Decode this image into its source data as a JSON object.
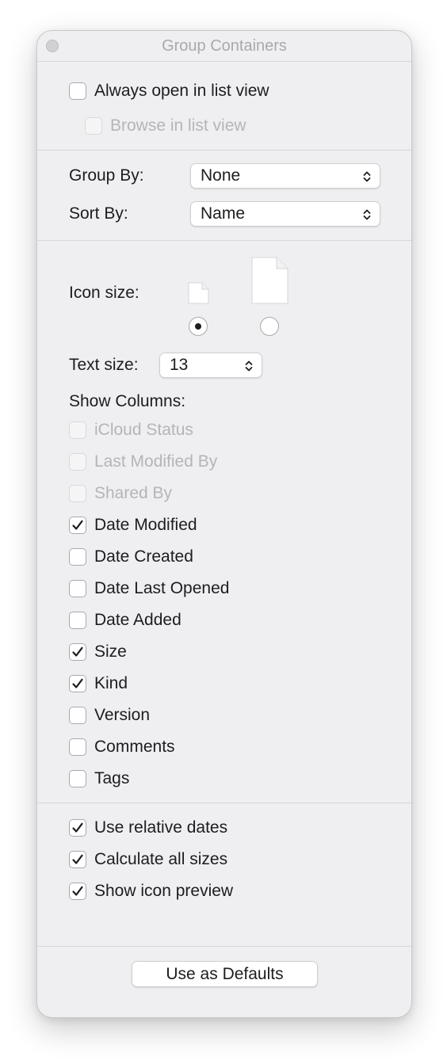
{
  "window": {
    "title": "Group Containers"
  },
  "browse_options": [
    {
      "label": "Always open in list view",
      "checked": false,
      "disabled": false
    },
    {
      "label": "Browse in list view",
      "checked": false,
      "disabled": true
    }
  ],
  "grouping": {
    "group_by_label": "Group By:",
    "group_by_value": "None",
    "sort_by_label": "Sort By:",
    "sort_by_value": "Name"
  },
  "icon_size": {
    "label": "Icon size:",
    "selected": "small"
  },
  "text_size": {
    "label": "Text size:",
    "value": "13"
  },
  "columns": {
    "header": "Show Columns:",
    "items": [
      {
        "label": "iCloud Status",
        "checked": false,
        "disabled": true
      },
      {
        "label": "Last Modified By",
        "checked": false,
        "disabled": true
      },
      {
        "label": "Shared By",
        "checked": false,
        "disabled": true
      },
      {
        "label": "Date Modified",
        "checked": true,
        "disabled": false
      },
      {
        "label": "Date Created",
        "checked": false,
        "disabled": false
      },
      {
        "label": "Date Last Opened",
        "checked": false,
        "disabled": false
      },
      {
        "label": "Date Added",
        "checked": false,
        "disabled": false
      },
      {
        "label": "Size",
        "checked": true,
        "disabled": false
      },
      {
        "label": "Kind",
        "checked": true,
        "disabled": false
      },
      {
        "label": "Version",
        "checked": false,
        "disabled": false
      },
      {
        "label": "Comments",
        "checked": false,
        "disabled": false
      },
      {
        "label": "Tags",
        "checked": false,
        "disabled": false
      }
    ]
  },
  "extra_options": [
    {
      "label": "Use relative dates",
      "checked": true,
      "disabled": false
    },
    {
      "label": "Calculate all sizes",
      "checked": true,
      "disabled": false
    },
    {
      "label": "Show icon preview",
      "checked": true,
      "disabled": false
    }
  ],
  "footer": {
    "defaults_button": "Use as Defaults"
  },
  "icons": {
    "checkmark": "checkmark-icon",
    "popup_chevron": "chevron-up-down-icon",
    "document": "document-icon"
  },
  "colors": {
    "window_bg": "#efeff1",
    "text": "#1d1d1f",
    "disabled_text": "#b5b5b9",
    "title_text": "#a9a9ad"
  }
}
